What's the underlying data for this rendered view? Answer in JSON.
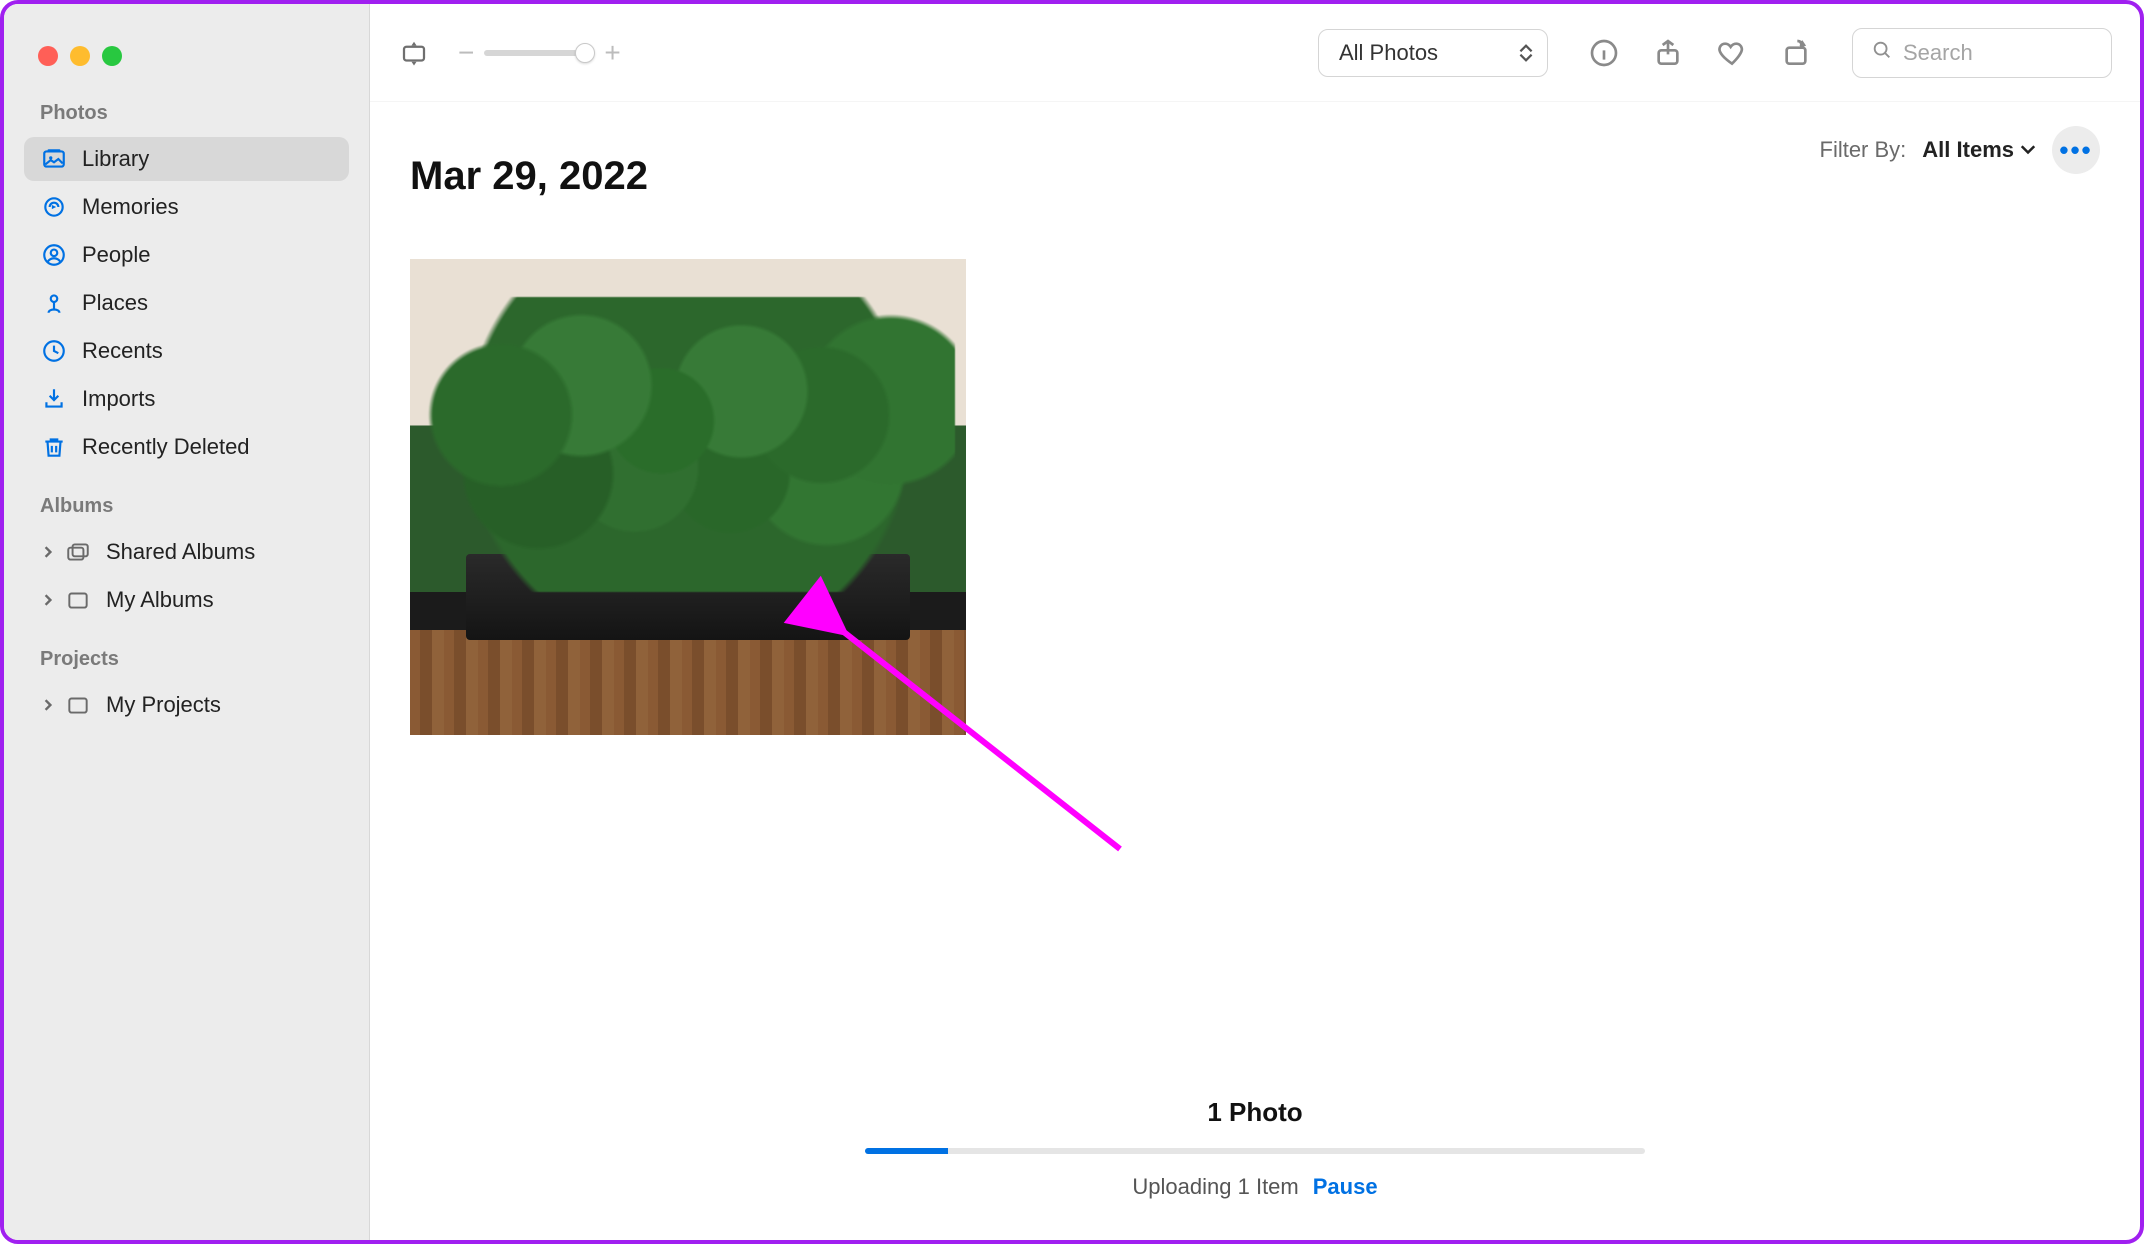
{
  "colors": {
    "accent": "#0071e3"
  },
  "sidebar": {
    "sections": {
      "photos": {
        "header": "Photos"
      },
      "albums": {
        "header": "Albums"
      },
      "projects": {
        "header": "Projects"
      }
    },
    "items": {
      "library": {
        "label": "Library",
        "selected": true
      },
      "memories": {
        "label": "Memories"
      },
      "people": {
        "label": "People"
      },
      "places": {
        "label": "Places"
      },
      "recents": {
        "label": "Recents"
      },
      "imports": {
        "label": "Imports"
      },
      "recently_deleted": {
        "label": "Recently Deleted"
      },
      "shared_albums": {
        "label": "Shared Albums"
      },
      "my_albums": {
        "label": "My Albums"
      },
      "my_projects": {
        "label": "My Projects"
      }
    }
  },
  "toolbar": {
    "view_select": {
      "value": "All Photos"
    },
    "search": {
      "placeholder": "Search"
    }
  },
  "filter": {
    "label": "Filter By:",
    "value": "All Items"
  },
  "content": {
    "date_heading": "Mar 29, 2022",
    "photo_description": "green moss in black planter on wooden table"
  },
  "footer": {
    "count_text": "1 Photo",
    "upload_text": "Uploading 1 Item",
    "pause_label": "Pause",
    "progress_percent": 10.7
  },
  "annotation": {
    "type": "arrow",
    "color": "#ff00ff",
    "points_to": "photo-thumbnail"
  }
}
